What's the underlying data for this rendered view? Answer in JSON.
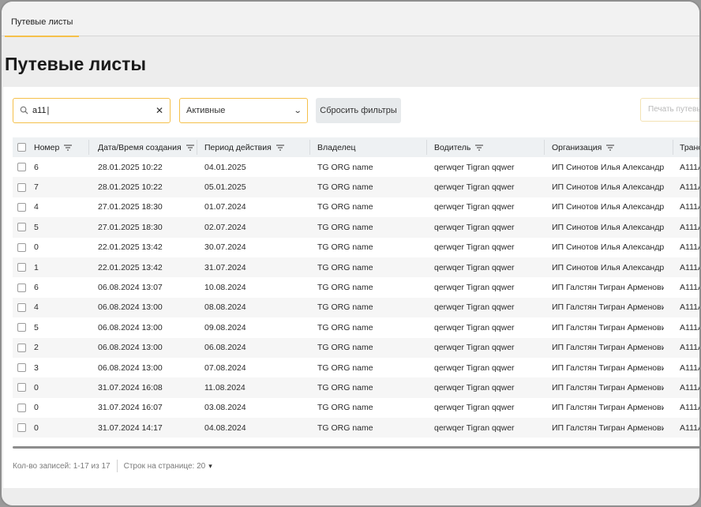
{
  "tab": {
    "label": "Путевые листы"
  },
  "page_title": "Путевые листы",
  "filters": {
    "search_value": "а11",
    "status_select": "Активные",
    "reset_label": "Сбросить фильтры",
    "print_label": "Печать путевых"
  },
  "table": {
    "headers": {
      "number": "Номер",
      "created": "Дата/Время создания",
      "period": "Период действия",
      "owner": "Владелец",
      "driver": "Водитель",
      "org": "Организация",
      "transport": "Транс"
    },
    "rows": [
      {
        "number": "6",
        "created": "28.01.2025 10:22",
        "period": "04.01.2025",
        "owner": "TG ORG name",
        "driver": "qerwqer Tigran qqwer",
        "org": "ИП Синотов Илья Александров...",
        "transport": "А111А"
      },
      {
        "number": "7",
        "created": "28.01.2025 10:22",
        "period": "05.01.2025",
        "owner": "TG ORG name",
        "driver": "qerwqer Tigran qqwer",
        "org": "ИП Синотов Илья Александров...",
        "transport": "А111А"
      },
      {
        "number": "4",
        "created": "27.01.2025 18:30",
        "period": "01.07.2024",
        "owner": "TG ORG name",
        "driver": "qerwqer Tigran qqwer",
        "org": "ИП Синотов Илья Александров...",
        "transport": "А111А"
      },
      {
        "number": "5",
        "created": "27.01.2025 18:30",
        "period": "02.07.2024",
        "owner": "TG ORG name",
        "driver": "qerwqer Tigran qqwer",
        "org": "ИП Синотов Илья Александров...",
        "transport": "А111А"
      },
      {
        "number": "0",
        "created": "22.01.2025 13:42",
        "period": "30.07.2024",
        "owner": "TG ORG name",
        "driver": "qerwqer Tigran qqwer",
        "org": "ИП Синотов Илья Александров...",
        "transport": "А111А"
      },
      {
        "number": "1",
        "created": "22.01.2025 13:42",
        "period": "31.07.2024",
        "owner": "TG ORG name",
        "driver": "qerwqer Tigran qqwer",
        "org": "ИП Синотов Илья Александров...",
        "transport": "А111А"
      },
      {
        "number": "6",
        "created": "06.08.2024 13:07",
        "period": "10.08.2024",
        "owner": "TG ORG name",
        "driver": "qerwqer Tigran qqwer",
        "org": "ИП Галстян Тигран Арменович",
        "transport": "А111А"
      },
      {
        "number": "4",
        "created": "06.08.2024 13:00",
        "period": "08.08.2024",
        "owner": "TG ORG name",
        "driver": "qerwqer Tigran qqwer",
        "org": "ИП Галстян Тигран Арменович",
        "transport": "А111А"
      },
      {
        "number": "5",
        "created": "06.08.2024 13:00",
        "period": "09.08.2024",
        "owner": "TG ORG name",
        "driver": "qerwqer Tigran qqwer",
        "org": "ИП Галстян Тигран Арменович",
        "transport": "А111А"
      },
      {
        "number": "2",
        "created": "06.08.2024 13:00",
        "period": "06.08.2024",
        "owner": "TG ORG name",
        "driver": "qerwqer Tigran qqwer",
        "org": "ИП Галстян Тигран Арменович",
        "transport": "А111А"
      },
      {
        "number": "3",
        "created": "06.08.2024 13:00",
        "period": "07.08.2024",
        "owner": "TG ORG name",
        "driver": "qerwqer Tigran qqwer",
        "org": "ИП Галстян Тигран Арменович",
        "transport": "А111А"
      },
      {
        "number": "0",
        "created": "31.07.2024 16:08",
        "period": "11.08.2024",
        "owner": "TG ORG name",
        "driver": "qerwqer Tigran qqwer",
        "org": "ИП Галстян Тигран Арменович",
        "transport": "А111А"
      },
      {
        "number": "0",
        "created": "31.07.2024 16:07",
        "period": "03.08.2024",
        "owner": "TG ORG name",
        "driver": "qerwqer Tigran qqwer",
        "org": "ИП Галстян Тигран Арменович",
        "transport": "А111А"
      },
      {
        "number": "0",
        "created": "31.07.2024 14:17",
        "period": "04.08.2024",
        "owner": "TG ORG name",
        "driver": "qerwqer Tigran qqwer",
        "org": "ИП Галстян Тигран Арменович",
        "transport": "А111А"
      }
    ]
  },
  "footer": {
    "records": "Кол-во записей: 1-17 из 17",
    "rows_per_page": "Строк на странице: 20"
  },
  "colors": {
    "accent": "#f5c04a",
    "header_bg": "#eef1f3",
    "alt_row": "#f6f6f6"
  }
}
